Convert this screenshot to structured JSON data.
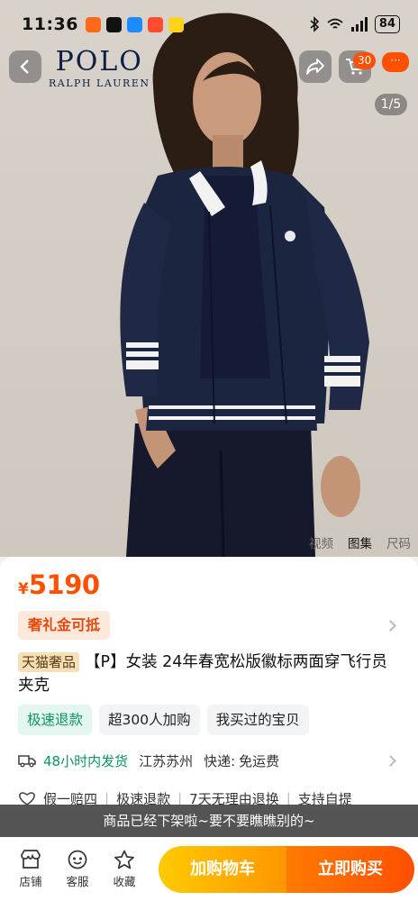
{
  "status_bar": {
    "time": "11:36",
    "battery": "84",
    "app_icons": [
      "taobao-app-icon",
      "tiktok-app-icon",
      "message-app-icon",
      "tool-app-icon",
      "camera-app-icon"
    ]
  },
  "header": {
    "brand_name": "POLO",
    "brand_sub": "RALPH LAUREN",
    "cart_badge": "30",
    "more_badge": "···"
  },
  "gallery": {
    "pager": "1/5",
    "tabs": [
      "视频",
      "图集",
      "尺码"
    ],
    "active_tab": "图集"
  },
  "product": {
    "currency": "¥",
    "price": "5190",
    "voucher": "奢礼金可抵",
    "store_tag": "天猫奢品",
    "title": "【P】女装 24年春宽松版徽标两面穿飞行员夹克",
    "chips": [
      "极速退款",
      "超300人加购",
      "我买过的宝贝"
    ],
    "shipping": {
      "time": "48小时内发货",
      "origin": "江苏苏州",
      "label": "快递:",
      "fee": "免运费"
    },
    "guarantees": [
      "假一赔四",
      "极速退款",
      "7天无理由退换",
      "支持自提"
    ]
  },
  "toast": "商品已经下架啦~要不要瞧瞧别的~",
  "bottom_bar": {
    "store": "店铺",
    "service": "客服",
    "favorite": "收藏",
    "add_to_cart": "加购物车",
    "buy_now": "立即购买"
  },
  "colors": {
    "accent": "#ff5000",
    "green": "#0c9466",
    "jacket": "#1c2540"
  }
}
